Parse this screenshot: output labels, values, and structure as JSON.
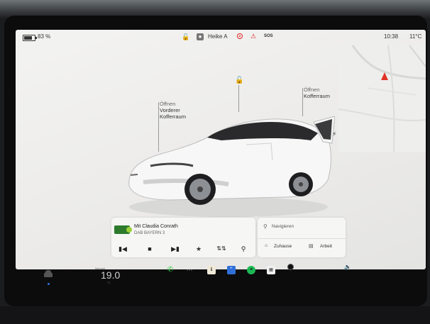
{
  "status_bar": {
    "battery_percent": "83 %",
    "profile_name": "Heike A",
    "sos_label": "SOS",
    "time": "10:38",
    "outside_temp": "11°C"
  },
  "car_view": {
    "frunk_action": "Öffnen",
    "frunk_line1": "Vorderer",
    "frunk_line2": "Kofferraum",
    "trunk_action": "Öffnen",
    "trunk_line1": "Kofferraum"
  },
  "media": {
    "program_title": "Mit Claudia Conrath",
    "station_name": "DAB BAYERN 3"
  },
  "navigation": {
    "search_placeholder": "Navigieren",
    "home_label": "Zuhause",
    "work_label": "Arbeit"
  },
  "climate": {
    "mode_label": "Manuell",
    "cabin_temp": "19.0",
    "sub_label": "°C"
  },
  "icons": {
    "status": [
      "battery-icon",
      "lock-icon",
      "profile-icon",
      "record-icon",
      "passenger-airbag-icon"
    ],
    "dock": [
      "car-icon",
      "phone-icon",
      "more-apps-icon",
      "info-icon",
      "bluetooth-icon",
      "spotify-icon",
      "calendar-icon",
      "camera-icon",
      "volume-icon"
    ]
  },
  "colors": {
    "accent_red": "#e03326",
    "bluetooth": "#2f6fd8",
    "spotify": "#1db954",
    "phone": "#2ecc40"
  }
}
